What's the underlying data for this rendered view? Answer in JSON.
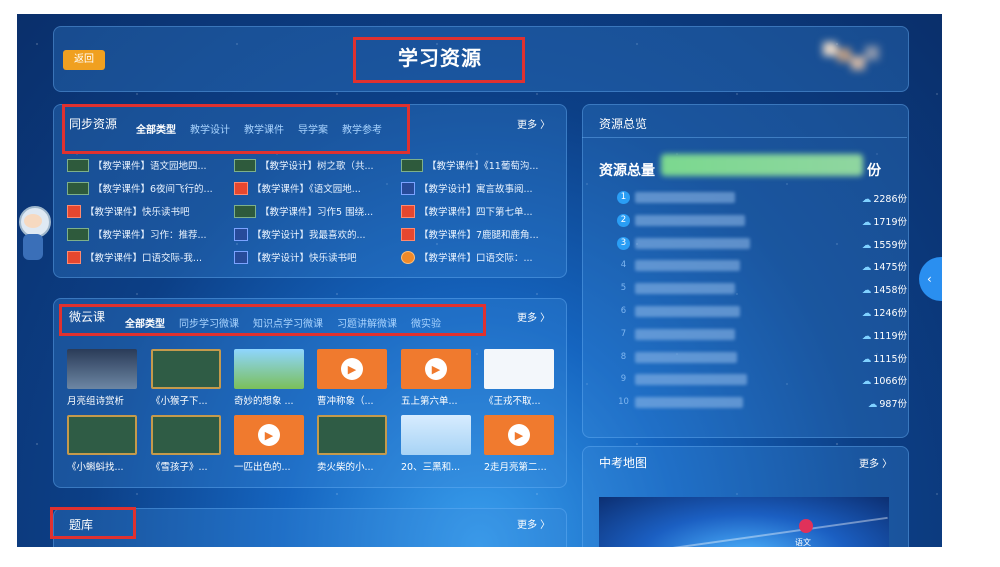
{
  "header": {
    "back": "返回",
    "title": "学习资源"
  },
  "sync": {
    "title": "同步资源",
    "tabs": [
      "全部类型",
      "教学设计",
      "教学课件",
      "导学案",
      "教学参考"
    ],
    "more": "更多 〉",
    "items": [
      [
        "【教学课件】语文园地四...",
        "【教学设计】树之歌（共...",
        "【教学课件】《11葡萄沟..."
      ],
      [
        "【教学课件】6夜间飞行的...",
        "【教学课件】《语文园地...",
        "【教学设计】寓言故事阅..."
      ],
      [
        "【教学课件】快乐读书吧",
        "【教学课件】习作5 围绕...",
        "【教学课件】四下第七单..."
      ],
      [
        "【教学课件】习作：推荐...",
        "【教学设计】我最喜欢的...",
        "【教学课件】7鹿腿和鹿角..."
      ],
      [
        "【教学课件】口语交际-我...",
        "【教学设计】快乐读书吧",
        "【教学课件】口语交际：..."
      ]
    ]
  },
  "micro": {
    "title": "微云课",
    "tabs": [
      "全部类型",
      "同步学习微课",
      "知识点学习微课",
      "习题讲解微课",
      "微实验"
    ],
    "more": "更多 〉",
    "row1": [
      "月亮组诗赏析",
      "《小猴子下...",
      "奇妙的想象 ...",
      "曹冲称象（...",
      "五上第六单...",
      "《王戎不取..."
    ],
    "row2": [
      "《小蝌蚪找...",
      "《雪孩子》...",
      "一匹出色的...",
      "卖火柴的小...",
      "20、三黑和...",
      "2走月亮第二..."
    ]
  },
  "tiku": {
    "title": "题库",
    "more": "更多 〉"
  },
  "overview": {
    "title": "资源总览",
    "total_label": "资源总量",
    "total_suffix": "份",
    "ranks": [
      {
        "n": "1",
        "v": "2286份"
      },
      {
        "n": "2",
        "v": "1719份"
      },
      {
        "n": "3",
        "v": "1559份"
      },
      {
        "n": "4",
        "v": "1475份"
      },
      {
        "n": "5",
        "v": "1458份"
      },
      {
        "n": "6",
        "v": "1246份"
      },
      {
        "n": "7",
        "v": "1119份"
      },
      {
        "n": "8",
        "v": "1115份"
      },
      {
        "n": "9",
        "v": "1066份"
      },
      {
        "n": "10",
        "v": "987份"
      }
    ]
  },
  "exam_map": {
    "title": "中考地图",
    "more": "更多 〉",
    "label": "语文"
  },
  "colors": {
    "accent": "#e0312f",
    "back_button": "#f0a020",
    "panel": "#3c8cdc"
  }
}
